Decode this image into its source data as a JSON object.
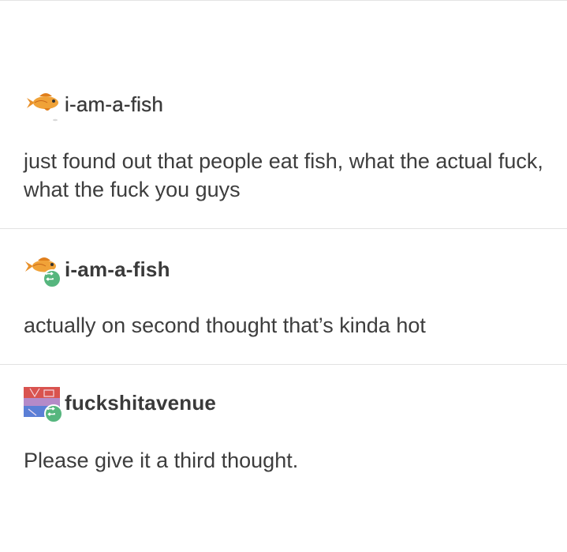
{
  "posts": [
    {
      "username": "i-am-a-fish",
      "text": "just found out that people eat fish, what the actual fuck, what the fuck you guys",
      "avatar_icon": "goldfish-icon",
      "reblog": false
    },
    {
      "username": "i-am-a-fish",
      "text": "actually on second thought that’s kinda hot",
      "avatar_icon": "goldfish-icon",
      "reblog": true
    },
    {
      "username": "fuckshitavenue",
      "text": "Please give it a third thought.",
      "avatar_icon": "colorful-avatar-icon",
      "reblog": true
    }
  ],
  "colors": {
    "reblog_badge": "#56b67e",
    "goldfish": "#e8902a",
    "text": "#3d3d3d",
    "divider": "#e2e2e2"
  }
}
